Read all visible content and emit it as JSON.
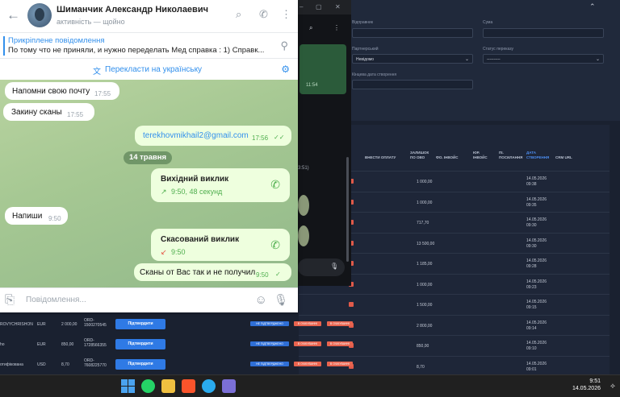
{
  "telegram": {
    "contact_name": "Шиманчик Александр Николаевич",
    "contact_status": "активність — щойно",
    "pinned_title": "Прикріплене повідомлення",
    "pinned_text": "По тому что не приняли, и нужно переделать Мед справка : 1) Справк...",
    "translate_label": "Перекласти на українську",
    "date_separator": "14 травня",
    "composer_placeholder": "Повідомлення...",
    "messages": [
      {
        "text": "Напомни свою почту",
        "time": "17:55",
        "dir": "in"
      },
      {
        "text": "Закину сканы",
        "time": "17:55",
        "dir": "in"
      },
      {
        "text": "terekhovmikhail2@gmail.com",
        "time": "17:56",
        "dir": "out"
      },
      {
        "title": "Вихідний виклик",
        "sub": "9:50, 48 секунд",
        "dir": "out"
      },
      {
        "text": "Напиши",
        "time": "9:50",
        "dir": "in"
      },
      {
        "title": "Скасований виклик",
        "sub": "9:50",
        "dir": "out"
      },
      {
        "text": "Сканы от Вас так и не получил",
        "time": "9:50",
        "dir": "out"
      }
    ]
  },
  "middle_window": {
    "time": "11:54",
    "partial_text": "3:51)"
  },
  "admin": {
    "labels": {
      "received": "Відправник",
      "amount": "Сума",
      "partner": "Партнерський",
      "partner_value": "Невідомо",
      "transfer_status": "Статус переказу",
      "transfer_value": "----------",
      "wallet_date": "Кінцева дата створення"
    },
    "columns": [
      "ВНЕСТИ ОПЛАТУ",
      "ЗАЛИШОК ПО ОВО",
      "ФО. ІНВОЙС",
      "ЮР. ІНВОЙС",
      "ПІ. ПОСИЛАННЯ",
      "ДАТА СТВОРЕННЯ",
      "CRM URL"
    ],
    "rows": [
      {
        "amount": "1 000,00",
        "date": "14.05.2026",
        "time": "09:38"
      },
      {
        "amount": "1 000,00",
        "date": "14.05.2026",
        "time": "09:35"
      },
      {
        "amount": "717,70",
        "date": "14.05.2026",
        "time": "09:30"
      },
      {
        "amount": "13 500,00",
        "date": "14.05.2026",
        "time": "09:30"
      },
      {
        "amount": "1 185,00",
        "date": "14.05.2026",
        "time": "09:28"
      },
      {
        "amount": "1 000,00",
        "date": "14.05.2026",
        "time": "09:23"
      },
      {
        "amount": "1 500,00",
        "date": "14.05.2026",
        "time": "09:15"
      },
      {
        "amount": "2 800,00",
        "date": "14.05.2026",
        "time": "09:14"
      },
      {
        "amount": "850,00",
        "date": "14.05.2026",
        "time": "09:10"
      },
      {
        "amount": "8,70",
        "date": "14.05.2026",
        "time": "09:01"
      }
    ],
    "bottom_rows": [
      {
        "name": "ROVYCHRISHON",
        "cur": "EUR",
        "amt": "2 000,00",
        "ord": "ORD-1500270545"
      },
      {
        "name": "ho",
        "cur": "EUR",
        "amt": "850,00",
        "ord": "ORD-1728566355"
      },
      {
        "name": "отифікована",
        "cur": "USD",
        "amt": "8,70",
        "ord": "ORD-7608225770"
      }
    ],
    "confirm_label": "Підтвердити",
    "tag_blue": "НЕ ПІДТВЕРДЖЕНО",
    "tag_red": "В ОЧІКУВАННІ"
  },
  "taskbar": {
    "time": "9:51",
    "date": "14.05.2026"
  }
}
